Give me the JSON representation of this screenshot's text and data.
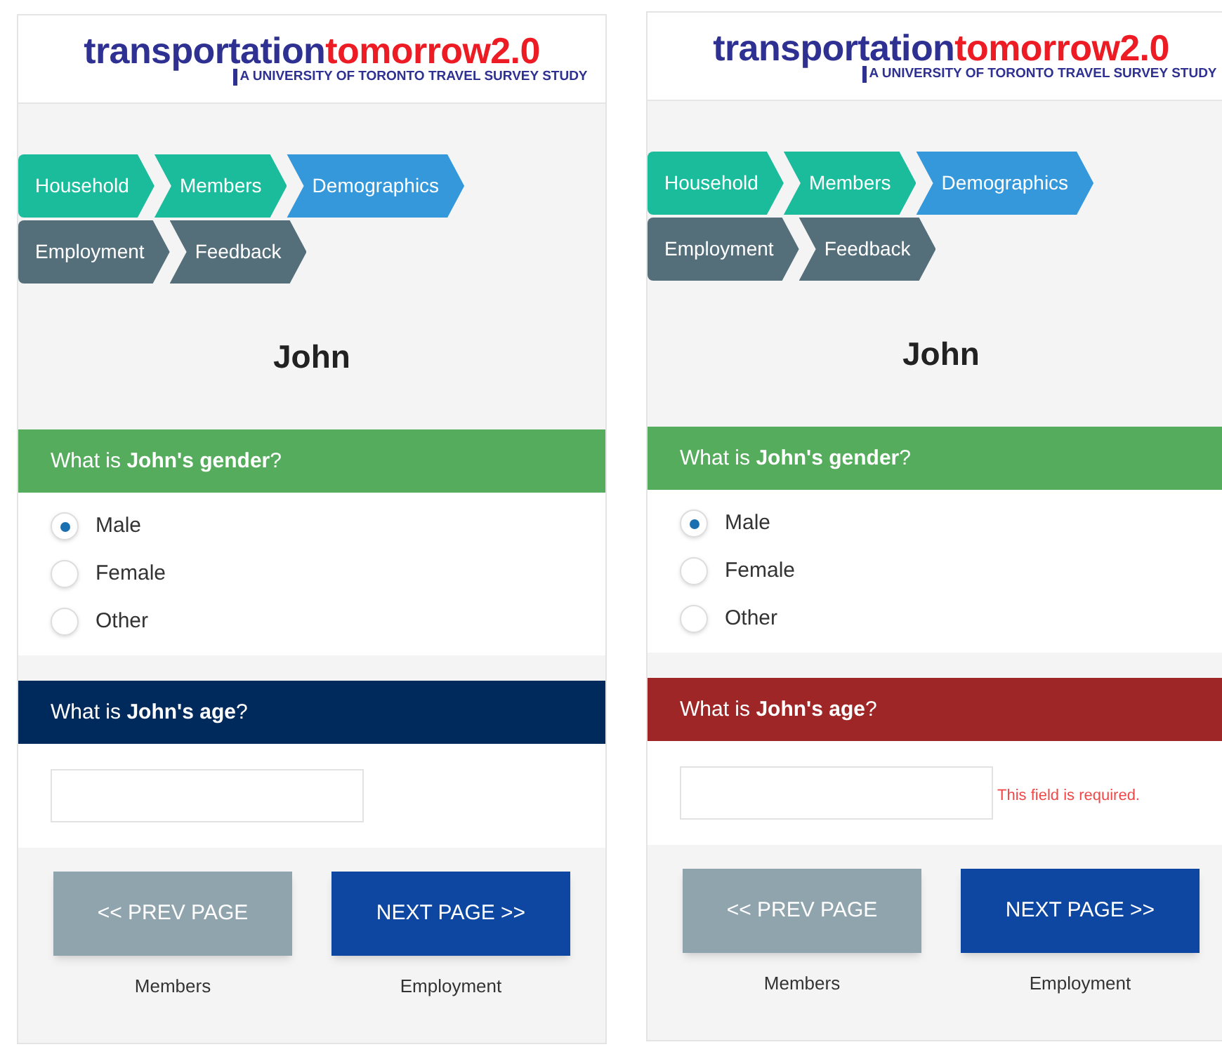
{
  "panels": [
    {
      "logo": {
        "part_1": "transportation",
        "part_2": "tomorrow2.0",
        "tagline": "A UNIVERSITY OF TORONTO TRAVEL SURVEY STUDY"
      },
      "steps": [
        {
          "label": "Household",
          "completed": true,
          "selected": false
        },
        {
          "label": "Members",
          "completed": true,
          "selected": false
        },
        {
          "label": "Demographics",
          "selected": true
        },
        {
          "label": "Employment",
          "completed": false,
          "selected": false
        },
        {
          "label": "Feedback",
          "completed": false,
          "selected": false
        }
      ],
      "person": "John",
      "questions": [
        {
          "kind": "radio",
          "answered": true,
          "invalid": false,
          "text": "What is **John's** **gender**?",
          "options": [
            {
              "label": "Male",
              "selected": true
            },
            {
              "label": "Female",
              "selected": false
            },
            {
              "label": "Other",
              "selected": false
            }
          ]
        },
        {
          "kind": "text",
          "answered": false,
          "invalid": false,
          "text": "What is **John's** **age**?"
        }
      ],
      "nav": [
        {
          "kind": "prev",
          "label": "<< PREV PAGE",
          "caption": "Members"
        },
        {
          "kind": "next",
          "label": "NEXT PAGE >>",
          "caption": "Employment"
        }
      ]
    },
    {
      "logo": {
        "part_1": "transportation",
        "part_2": "tomorrow2.0",
        "tagline": "A UNIVERSITY OF TORONTO TRAVEL SURVEY STUDY"
      },
      "steps": [
        {
          "label": "Household",
          "completed": true,
          "selected": false
        },
        {
          "label": "Members",
          "completed": true,
          "selected": false
        },
        {
          "label": "Demographics",
          "selected": true
        },
        {
          "label": "Employment",
          "completed": false,
          "selected": false
        },
        {
          "label": "Feedback",
          "completed": false,
          "selected": false
        }
      ],
      "person": "John",
      "questions": [
        {
          "kind": "radio",
          "answered": true,
          "invalid": false,
          "text": "What is **John's** **gender**?",
          "options": [
            {
              "label": "Male",
              "selected": true
            },
            {
              "label": "Female",
              "selected": false
            },
            {
              "label": "Other",
              "selected": false
            }
          ]
        },
        {
          "kind": "text",
          "invalid": true,
          "text": "What is **John's** **age**?",
          "error": "This field is required."
        }
      ],
      "nav": [
        {
          "kind": "prev",
          "label": "<< PREV PAGE",
          "caption": "Members"
        },
        {
          "kind": "next",
          "label": "NEXT PAGE >>",
          "caption": "Employment"
        }
      ]
    }
  ]
}
